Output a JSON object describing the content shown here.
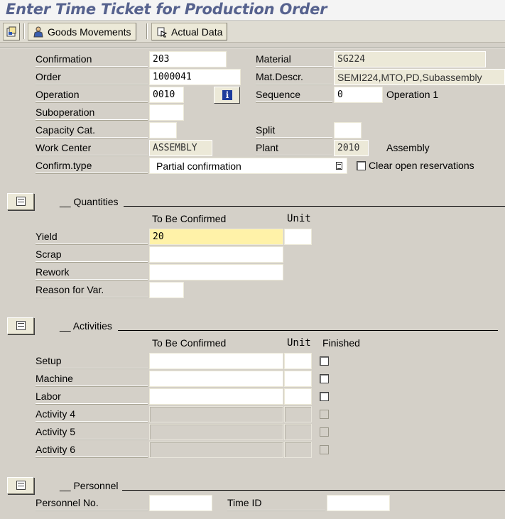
{
  "window": {
    "title": "Enter Time Ticket for Production Order"
  },
  "toolbar": {
    "goods_movements_label": "Goods Movements",
    "actual_data_label": "Actual Data",
    "icons": [
      "overview-icon",
      "goods-movements-icon",
      "actual-data-icon"
    ]
  },
  "header": {
    "confirmation_label": "Confirmation",
    "confirmation_value": "203",
    "order_label": "Order",
    "order_value": "1000041",
    "operation_label": "Operation",
    "operation_value": "0010",
    "suboperation_label": "Suboperation",
    "suboperation_value": "",
    "capacity_label": "Capacity Cat.",
    "capacity_value": "",
    "work_center_label": "Work Center",
    "work_center_value": "ASSEMBLY",
    "confirm_type_label": "Confirm.type",
    "confirm_type_value": "Partial confirmation",
    "material_label": "Material",
    "material_value": "SG224",
    "mat_descr_label": "Mat.Descr.",
    "mat_descr_value": "SEMI224,MTO,PD,Subassembly",
    "sequence_label": "Sequence",
    "sequence_value": "0",
    "sequence_text": "Operation 1",
    "split_label": "Split",
    "split_value": "",
    "plant_label": "Plant",
    "plant_value": "2010",
    "plant_text": "Assembly",
    "clear_reservations_label": "Clear open reservations",
    "clear_reservations_checked": false
  },
  "quantities": {
    "title": "__ Quantities",
    "col_to_be_confirmed": "To Be Confirmed",
    "col_unit": "Unit",
    "yield_label": "Yield",
    "yield_value": "20",
    "scrap_label": "Scrap",
    "scrap_value": "",
    "rework_label": "Rework",
    "rework_value": "",
    "reason_label": "Reason for Var.",
    "reason_value": ""
  },
  "activities": {
    "title": "__ Activities",
    "col_to_be_confirmed": "To Be Confirmed",
    "col_unit": "Unit",
    "col_finished": "Finished",
    "rows": [
      {
        "label": "Setup",
        "value": "",
        "unit": "",
        "finished": false,
        "enabled": true
      },
      {
        "label": "Machine",
        "value": "",
        "unit": "",
        "finished": false,
        "enabled": true
      },
      {
        "label": "Labor",
        "value": "",
        "unit": "",
        "finished": false,
        "enabled": true
      },
      {
        "label": "Activity 4",
        "value": "",
        "unit": "",
        "finished": false,
        "enabled": false
      },
      {
        "label": "Activity 5",
        "value": "",
        "unit": "",
        "finished": false,
        "enabled": false
      },
      {
        "label": "Activity 6",
        "value": "",
        "unit": "",
        "finished": false,
        "enabled": false
      }
    ]
  },
  "personnel": {
    "title": "__ Personnel",
    "personnel_no_label": "Personnel No.",
    "personnel_no_value": "",
    "time_id_label": "Time ID",
    "time_id_value": ""
  },
  "colors": {
    "title": "#56628e",
    "background": "#d4d0c8",
    "required_field": "#fff2a8",
    "info_icon": "#1d3c9c"
  }
}
